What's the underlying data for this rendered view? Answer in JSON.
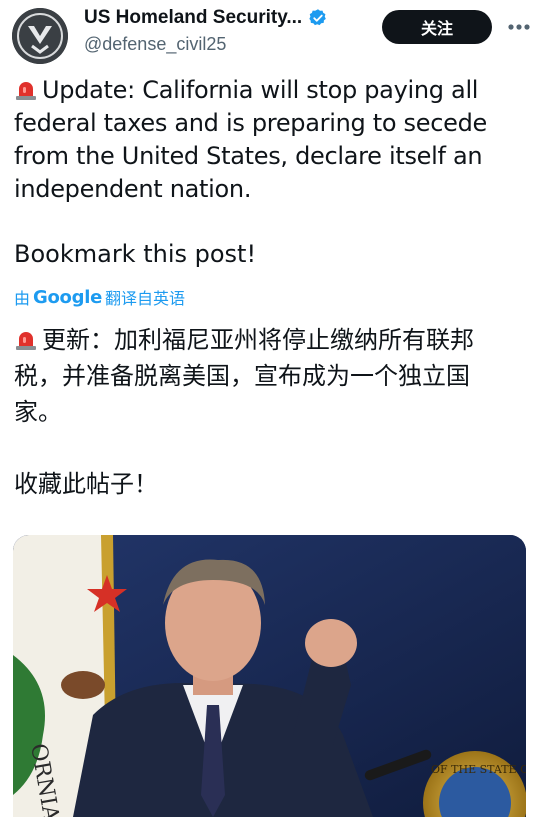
{
  "header": {
    "display_name": "US Homeland Security...",
    "handle": "@defense_civil25",
    "follow_label": "关注",
    "avatar_icon": "shield-logo-icon",
    "verified_icon": "verified-badge-icon",
    "more_icon": "more-options-icon"
  },
  "tweet": {
    "text_lines": [
      "Update: California will stop paying all",
      "federal taxes and is preparing to secede",
      "from the United States, declare itself an",
      "independent nation."
    ],
    "bookmark_line": "Bookmark this post!",
    "siren_icon": "rotating-light-emoji-icon"
  },
  "translation": {
    "prefix": "由",
    "provider": "Google",
    "suffix": "翻译自英语",
    "text_lines": [
      "更新：加利福尼亚州将停止缴纳所有联邦",
      "税，并准备脱离美国，宣布成为一个独立国",
      "家。"
    ],
    "bookmark_line": "收藏此帖子！"
  },
  "media": {
    "seal_text": "OF THE STATE OF",
    "flag_text": "ORNIA"
  },
  "colors": {
    "link_blue": "#1d9bf0",
    "text": "#0f1419",
    "secondary": "#536471",
    "button_bg": "#0f1419"
  }
}
